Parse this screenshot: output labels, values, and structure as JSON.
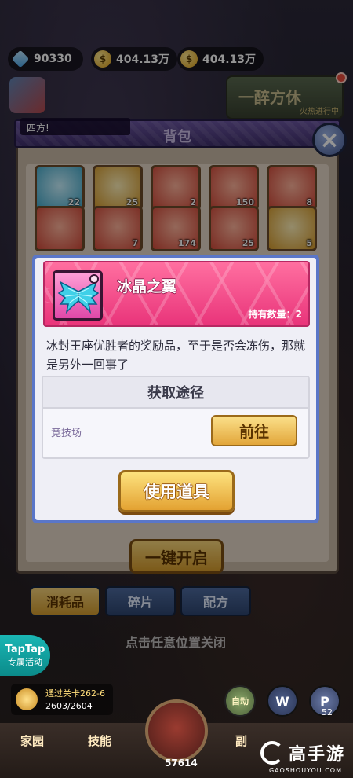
{
  "resources": {
    "gems": "90330",
    "coins_1": "404.13万",
    "coins_2": "404.13万"
  },
  "event": {
    "title": "一醉方休",
    "subtitle": "火热进行中"
  },
  "toast": "四方!",
  "bag": {
    "title": "背包",
    "items_row1": [
      "22",
      "25",
      "2",
      "150",
      "8"
    ],
    "items_row2": [
      "",
      "7",
      "174",
      "25",
      "5"
    ],
    "open_all": "一键开启",
    "tabs": [
      {
        "label": "消耗品",
        "active": true
      },
      {
        "label": "碎片",
        "active": false
      },
      {
        "label": "配方",
        "active": false
      }
    ],
    "tap_close": "点击任意位置关闭"
  },
  "popup": {
    "item_name": "冰晶之翼",
    "quantity": "持有数量：2",
    "description": "冰封王座优胜者的奖励品，至于是否会冻伤，那就是另外一回事了",
    "source_title": "获取途径",
    "source_name": "竞技场",
    "goto_label": "前往",
    "use_label": "使用道具"
  },
  "taptap": {
    "line1": "TapTap",
    "line2": "专属活动"
  },
  "stage": {
    "line1": "通过关卡262-6",
    "line2": "2603/2604"
  },
  "controls": {
    "auto": "自动",
    "w": "W",
    "p_count": "52"
  },
  "bottom_nav": {
    "home": "家园",
    "skill": "技能",
    "center_count": "57614",
    "right": "副"
  },
  "watermark": {
    "text": "高手游",
    "url": "GAOSHOUYOU.COM"
  },
  "colors": {
    "accent_pink": "#e9347a",
    "button_gold": "#e3a232",
    "popup_border": "#5a76c8"
  }
}
